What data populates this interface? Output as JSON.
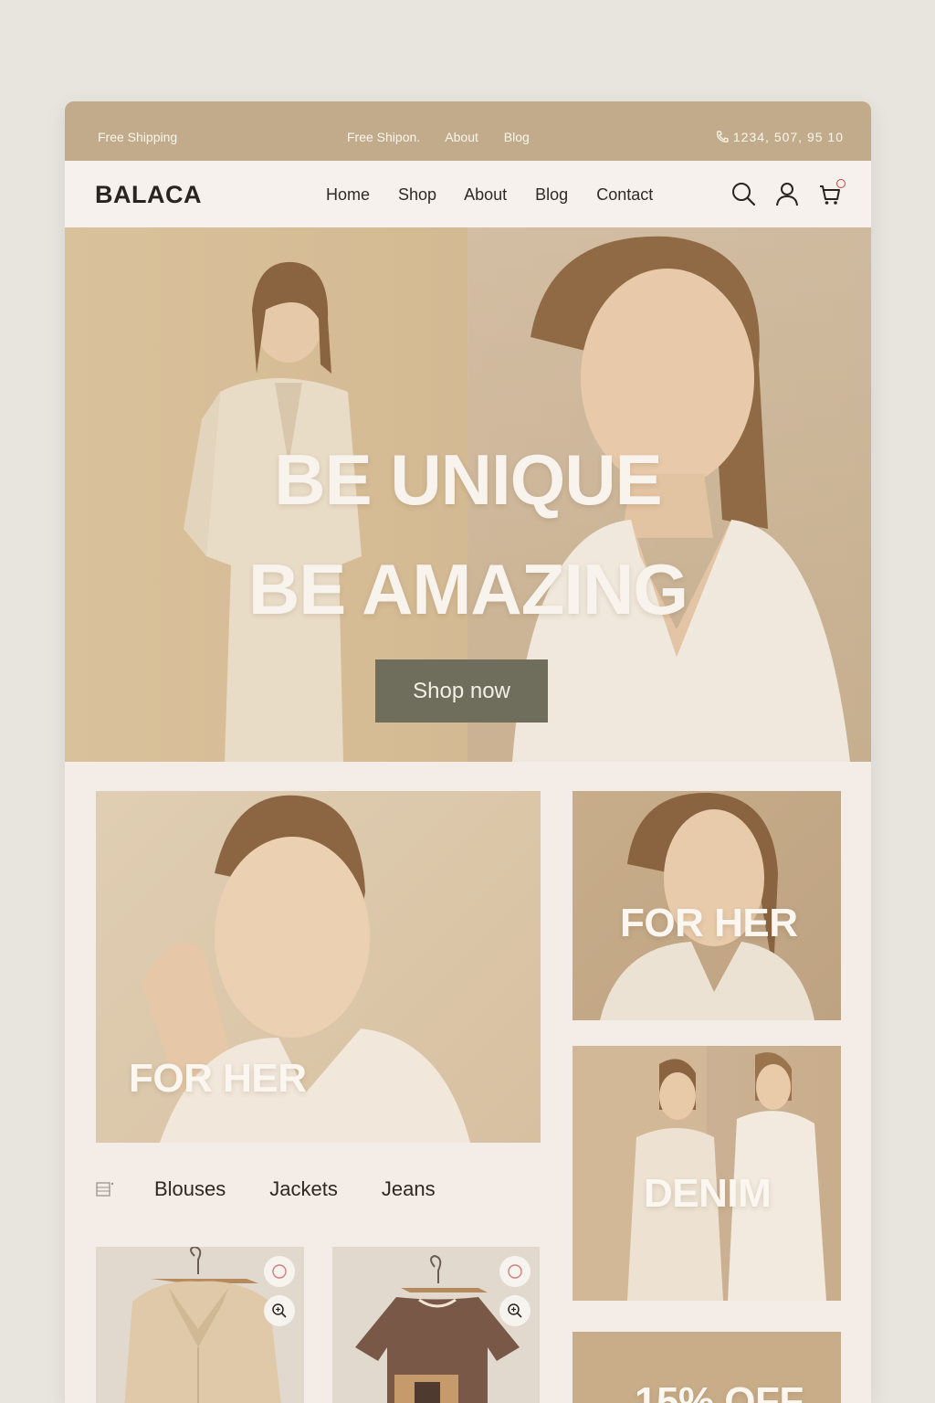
{
  "topbar": {
    "shipping": "Free Shipping",
    "links": [
      "Free Shipon.",
      "About",
      "Blog"
    ],
    "phone": "1234, 507, 95 10"
  },
  "nav": {
    "logo": "BALACA",
    "links": [
      "Home",
      "Shop",
      "About",
      "Blog",
      "Contact"
    ],
    "icons": [
      "search-icon",
      "user-icon",
      "cart-icon"
    ]
  },
  "hero": {
    "line1": "BE UNIQUE",
    "line2": "BE AMAZING",
    "cta": "Shop now"
  },
  "cards": {
    "main": "FOR HER",
    "side1": "FOR HER",
    "side2": "DENIM",
    "promo": "15% OFF"
  },
  "categories": [
    "Blouses",
    "Jackets",
    "Jeans"
  ],
  "colors": {
    "topbar": "#c2ab8a",
    "accent_button": "#6f6e5c",
    "background": "#f3ece7",
    "cart_badge": "#c8443a"
  }
}
